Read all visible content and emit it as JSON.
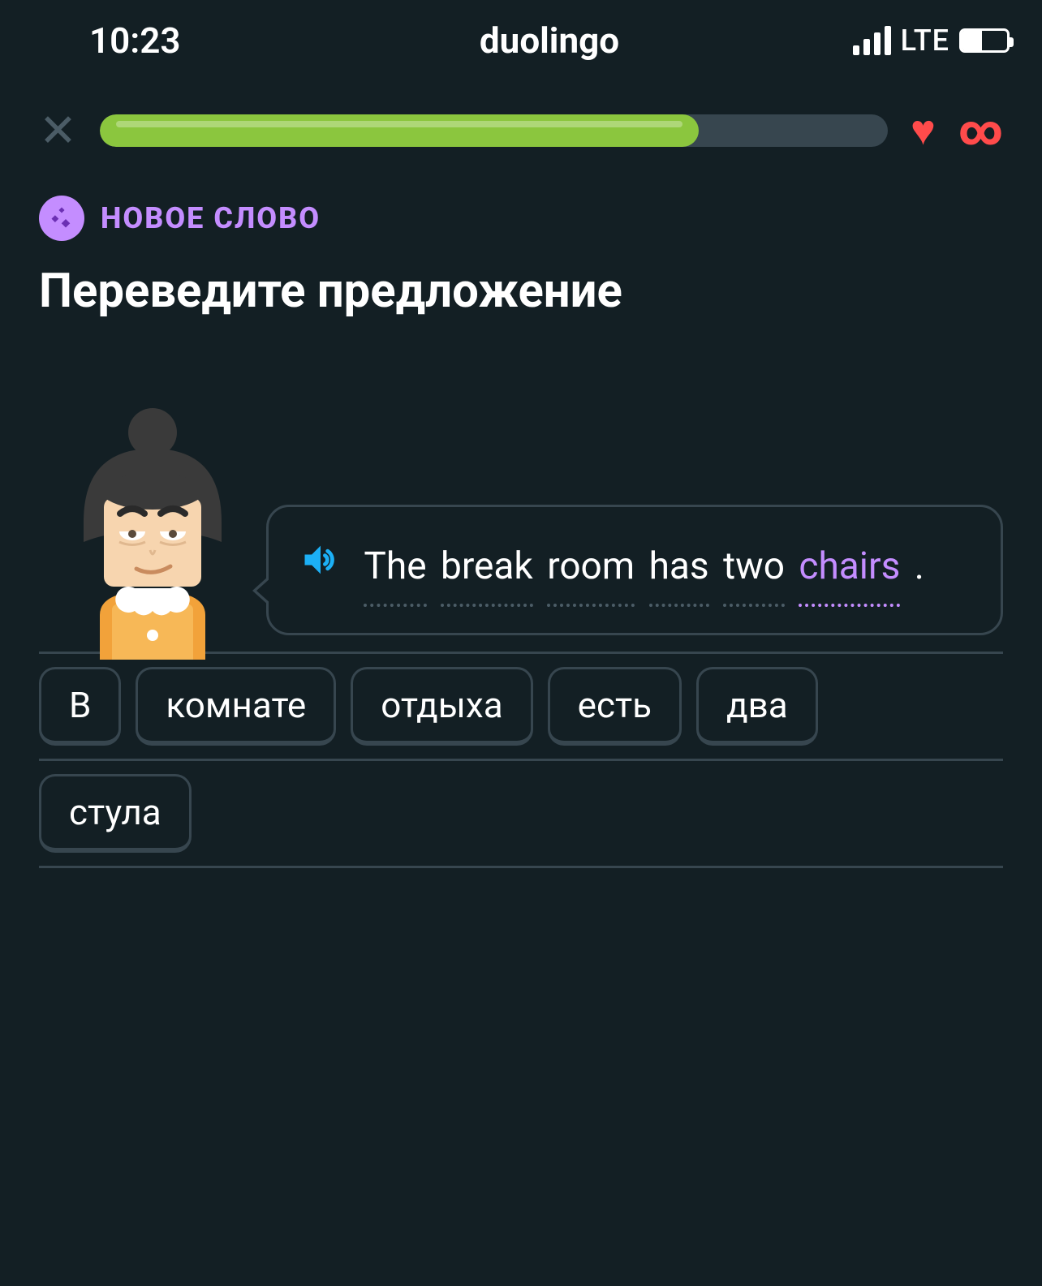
{
  "status": {
    "time": "10:23",
    "app": "duolingo",
    "network": "LTE",
    "battery_pct": 45
  },
  "progress": {
    "close_glyph": "✕",
    "percent": 76,
    "heart_glyph": "♥",
    "infinity_glyph": "∞"
  },
  "badge": {
    "label": "НОВОЕ СЛОВО"
  },
  "prompt": "Переведите предложение",
  "sentence": {
    "words": [
      {
        "text": "The",
        "highlight": false
      },
      {
        "text": "break",
        "highlight": false
      },
      {
        "text": "room",
        "highlight": false
      },
      {
        "text": "has",
        "highlight": false
      },
      {
        "text": "two",
        "highlight": false
      },
      {
        "text": "chairs",
        "highlight": true
      }
    ],
    "trailing": "."
  },
  "answer_row1": [
    "В",
    "комнате",
    "отдыха",
    "есть",
    "два"
  ],
  "answer_row2": [
    "стула"
  ],
  "colors": {
    "bg": "#131f24",
    "accent_purple": "#c48dff",
    "green": "#8bc63e",
    "red": "#ff4b4b",
    "blue": "#1cb0f6"
  }
}
